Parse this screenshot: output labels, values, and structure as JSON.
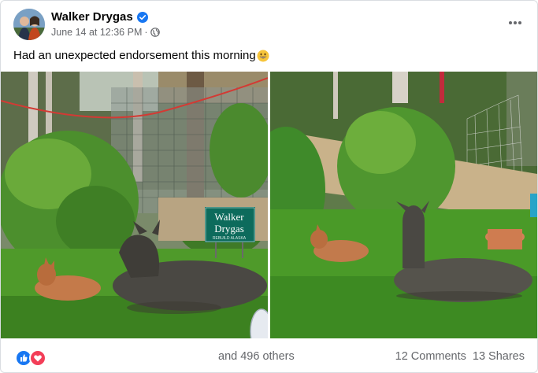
{
  "post": {
    "author": "Walker Drygas",
    "timestamp": "June 14 at 12:36 PM",
    "separator": "·",
    "privacy_icon": "globe-icon",
    "verified_icon": "verified-badge-icon",
    "more_icon": "more-options-icon",
    "caption": "Had an unexpected endorsement this morning",
    "caption_emoji": "grinning-face-emoji",
    "sign_text": {
      "line1": "Walker",
      "line2": "Drygas",
      "line3": "REBUILD ALASKA"
    }
  },
  "footer": {
    "reaction_icons": [
      "like-icon",
      "love-icon"
    ],
    "others_text": "and 496 others",
    "comments_text": "12 Comments",
    "shares_text": "13 Shares"
  },
  "colors": {
    "facebook_blue": "#1877f2",
    "love_red": "#f33e58",
    "secondary_text": "#65676b",
    "sign_green": "#0d6b5c"
  }
}
